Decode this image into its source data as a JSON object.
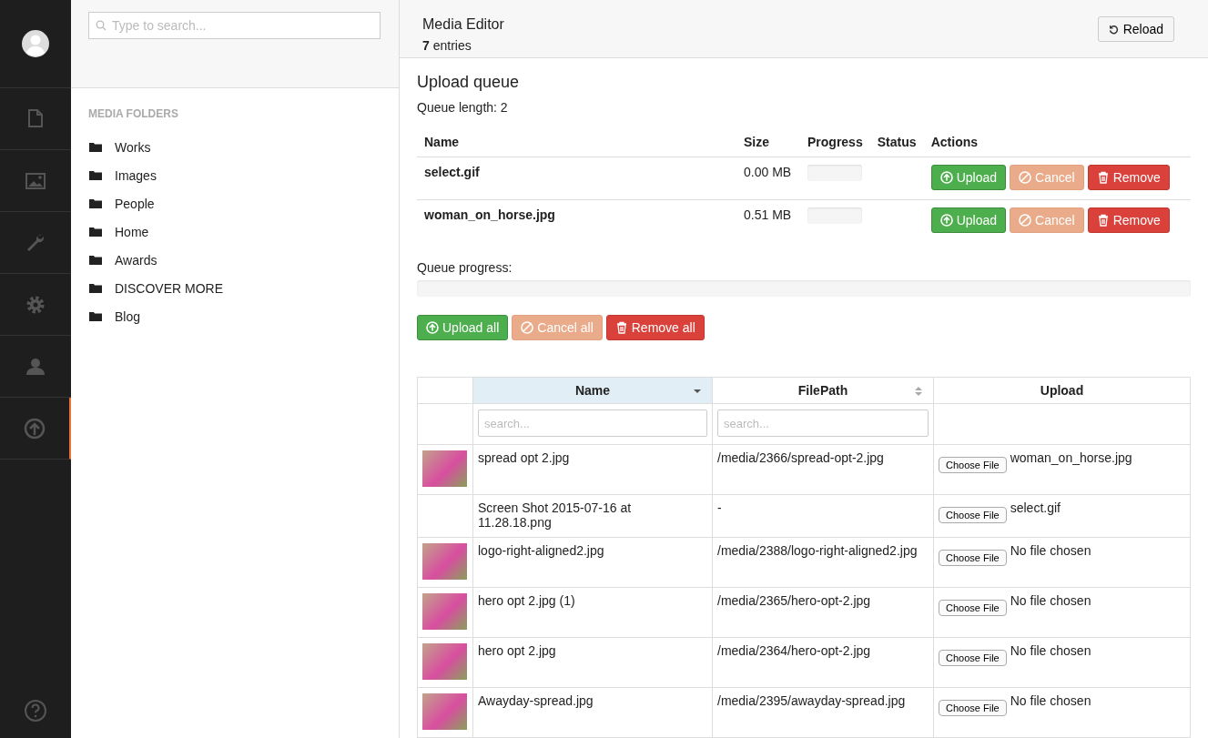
{
  "nav": [
    {
      "selected": false
    },
    {
      "selected": false
    },
    {
      "selected": false
    },
    {
      "selected": false
    },
    {
      "selected": false
    },
    {
      "selected": true
    }
  ],
  "search": {
    "placeholder": "Type to search..."
  },
  "folders": {
    "title": "MEDIA FOLDERS",
    "items": [
      "Works",
      "Images",
      "People",
      "Home",
      "Awards",
      "DISCOVER MORE",
      "Blog"
    ]
  },
  "header": {
    "title": "Media Editor",
    "entries": "**7** entries",
    "reload": "Reload"
  },
  "queue": {
    "title": "Upload queue",
    "length": "Queue length: 2",
    "columns": [
      "Name",
      "Size",
      "Progress",
      "Status",
      "Actions"
    ],
    "items": [
      {
        "name": "select.gif",
        "size": "0.00 MB",
        "level": 0,
        "buttons": [
          "Upload",
          "Cancel",
          "Remove"
        ]
      },
      {
        "name": "woman_on_horse.jpg",
        "size": "0.51 MB",
        "level": 0,
        "buttons": [
          "Upload",
          "Cancel",
          "Remove"
        ]
      }
    ],
    "progress_label": "Queue progress:",
    "progress": {
      "level": 0
    },
    "all_buttons": [
      "Upload all",
      "Cancel all",
      "Remove all"
    ]
  },
  "table": {
    "columns": [
      {
        "label": "Name",
        "sorted": true,
        "placeholder": "search..."
      },
      {
        "label": "FilePath",
        "sorted": false,
        "placeholder": "search..."
      },
      {
        "label": "Upload",
        "sorted": false
      }
    ],
    "rows": [
      {
        "thumbnail": true,
        "name": "spread opt 2.jpg",
        "path": "/media/2366/spread-opt-2.jpg",
        "choose": "Choose File",
        "file": "woman_on_horse.jpg"
      },
      {
        "thumbnail": false,
        "name": "Screen Shot 2015-07-16 at 11.28.18.png",
        "path": "-",
        "choose": "Choose File",
        "file": "select.gif"
      },
      {
        "thumbnail": true,
        "name": "logo-right-aligned2.jpg",
        "path": "/media/2388/logo-right-aligned2.jpg",
        "choose": "Choose File",
        "file": "No file chosen"
      },
      {
        "thumbnail": true,
        "name": "hero opt 2.jpg (1)",
        "path": "/media/2365/hero-opt-2.jpg",
        "choose": "Choose File",
        "file": "No file chosen"
      },
      {
        "thumbnail": true,
        "name": "hero opt 2.jpg",
        "path": "/media/2364/hero-opt-2.jpg",
        "choose": "Choose File",
        "file": "No file chosen"
      },
      {
        "thumbnail": true,
        "name": "Awayday-spread.jpg",
        "path": "/media/2395/awayday-spread.jpg",
        "choose": "Choose File",
        "file": "No file chosen"
      }
    ]
  }
}
